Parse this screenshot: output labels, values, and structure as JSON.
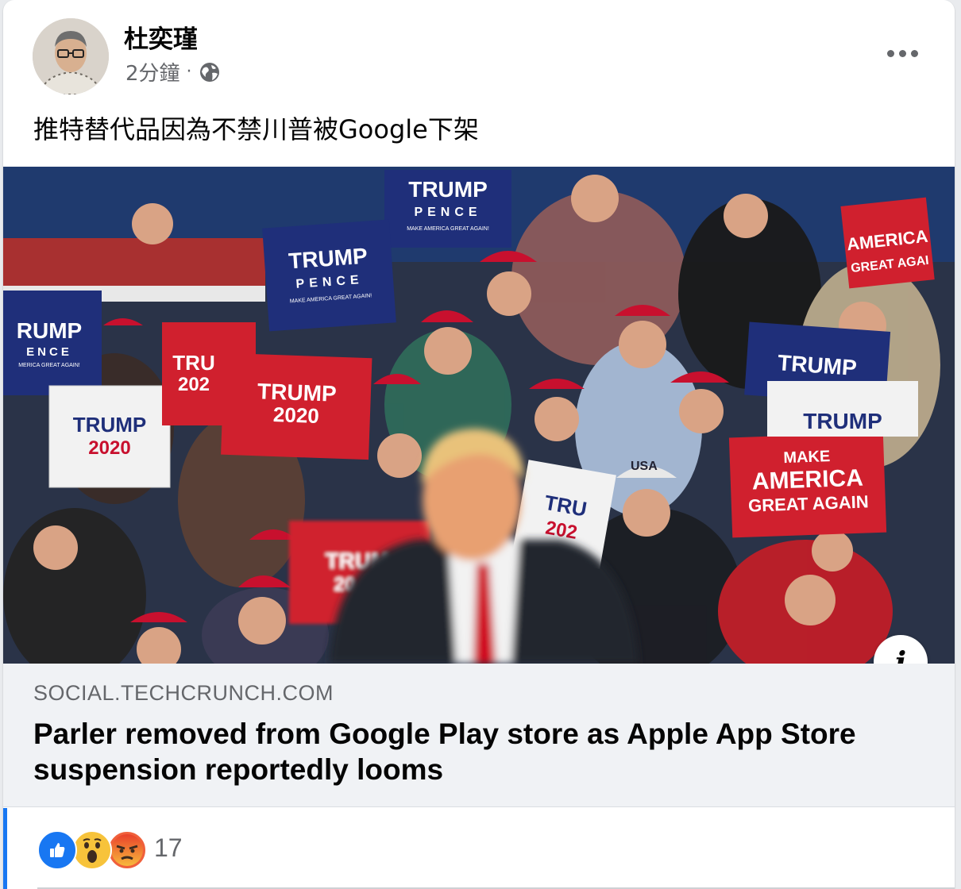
{
  "post": {
    "author": "杜奕瑾",
    "time": "2分鐘",
    "separator": "·",
    "text": "推特替代品因為不禁川普被Google下架"
  },
  "link_preview": {
    "domain": "SOCIAL.TECHCRUNCH.COM",
    "headline": "Parler removed from Google Play store as Apple App Store suspension reportedly looms",
    "image_signs": [
      {
        "lines": [
          "TRUMP",
          "PENCE",
          "MAKE AMERICA GREAT AGAIN!"
        ]
      },
      {
        "lines": [
          "TRUMP",
          "PENCE",
          "MAKE AMERICA GREAT AGAIN!"
        ]
      },
      {
        "lines": [
          "RUMP",
          "ENCE",
          "MERICA GREAT AGAIN!"
        ]
      },
      {
        "lines": [
          "TRUMP",
          "2020"
        ]
      },
      {
        "lines": [
          "TRUMP",
          "2020"
        ]
      },
      {
        "lines": [
          "TRU",
          "202"
        ]
      },
      {
        "lines": [
          "MAKE",
          "AMERICA",
          "GREAT AGAIN"
        ]
      },
      {
        "lines": [
          "TRUMP"
        ]
      },
      {
        "lines": [
          "TRUMP"
        ]
      },
      {
        "lines": [
          "AMERICA",
          "GREAT AGAI"
        ]
      },
      {
        "lines": [
          "TRUM",
          "20"
        ]
      },
      {
        "lines": [
          "TRU",
          "202"
        ]
      }
    ],
    "cap_text": "USA"
  },
  "reactions": {
    "count": "17",
    "types": [
      "like",
      "wow",
      "angry"
    ]
  },
  "colors": {
    "accent": "#1877f2",
    "maga_red": "#c8102e",
    "sign_blue": "#1f2f7a"
  },
  "icons": {
    "privacy": "globe-icon",
    "menu": "more-icon",
    "info": "info-icon"
  }
}
